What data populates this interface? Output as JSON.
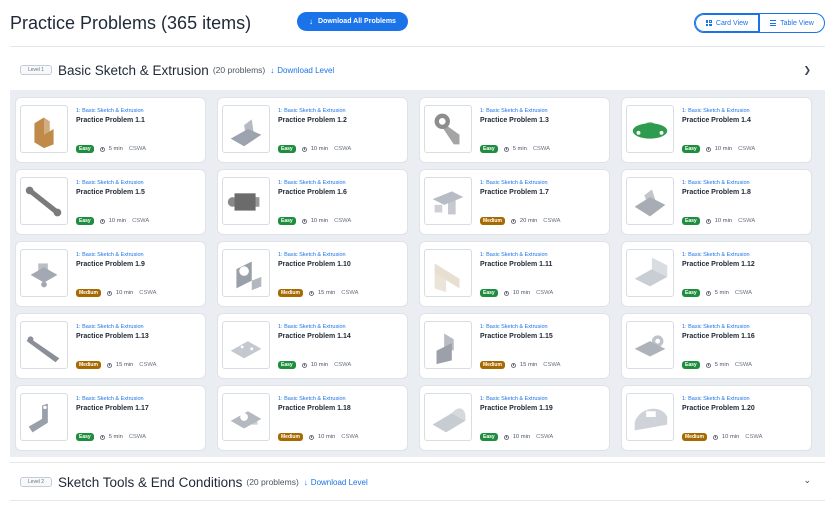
{
  "header": {
    "title": "Practice Problems (365 items)",
    "download_all_label": "Download All Problems",
    "views": [
      {
        "label": "Card View",
        "icon": "grid-icon",
        "active": true
      },
      {
        "label": "Table View",
        "icon": "list-icon",
        "active": false
      }
    ]
  },
  "levels": [
    {
      "badge": "Level 1",
      "title": "Basic Sketch & Extrusion",
      "count": "(20 problems)",
      "download_label": "Download Level",
      "chevron": "chevron-right-icon",
      "expanded": true
    },
    {
      "badge": "Level 2",
      "title": "Sketch Tools & End Conditions",
      "count": "(20 problems)",
      "download_label": "Download Level",
      "chevron": "chevron-down-icon",
      "expanded": false
    }
  ],
  "colors": {
    "accent": "#1a73e8",
    "easy": "#1e8e3e",
    "medium": "#a66a00",
    "panel_bg": "#eaedf1"
  },
  "cards": [
    {
      "category": "1: Basic Sketch & Extrusion",
      "title": "Practice Problem 1.1",
      "difficulty": "Easy",
      "time": "5 min",
      "tag": "CSWA",
      "part_color": "#c08a4a"
    },
    {
      "category": "1: Basic Sketch & Extrusion",
      "title": "Practice Problem 1.2",
      "difficulty": "Easy",
      "time": "10 min",
      "tag": "CSWA",
      "part_color": "#9ca3af"
    },
    {
      "category": "1: Basic Sketch & Extrusion",
      "title": "Practice Problem 1.3",
      "difficulty": "Easy",
      "time": "5 min",
      "tag": "CSWA",
      "part_color": "#8d8d8d"
    },
    {
      "category": "1: Basic Sketch & Extrusion",
      "title": "Practice Problem 1.4",
      "difficulty": "Easy",
      "time": "10 min",
      "tag": "CSWA",
      "part_color": "#2e9b4f"
    },
    {
      "category": "1: Basic Sketch & Extrusion",
      "title": "Practice Problem 1.5",
      "difficulty": "Easy",
      "time": "10 min",
      "tag": "CSWA",
      "part_color": "#7b7b7b"
    },
    {
      "category": "1: Basic Sketch & Extrusion",
      "title": "Practice Problem 1.6",
      "difficulty": "Easy",
      "time": "10 min",
      "tag": "CSWA",
      "part_color": "#6b6b6b"
    },
    {
      "category": "1: Basic Sketch & Extrusion",
      "title": "Practice Problem 1.7",
      "difficulty": "Medium",
      "time": "20 min",
      "tag": "CSWA",
      "part_color": "#b8bcc4"
    },
    {
      "category": "1: Basic Sketch & Extrusion",
      "title": "Practice Problem 1.8",
      "difficulty": "Easy",
      "time": "10 min",
      "tag": "CSWA",
      "part_color": "#a8acb4"
    },
    {
      "category": "1: Basic Sketch & Extrusion",
      "title": "Practice Problem 1.9",
      "difficulty": "Medium",
      "time": "10 min",
      "tag": "CSWA",
      "part_color": "#a3a8b2"
    },
    {
      "category": "1: Basic Sketch & Extrusion",
      "title": "Practice Problem 1.10",
      "difficulty": "Medium",
      "time": "15 min",
      "tag": "CSWA",
      "part_color": "#9aa0aa"
    },
    {
      "category": "1: Basic Sketch & Extrusion",
      "title": "Practice Problem 1.11",
      "difficulty": "Easy",
      "time": "10 min",
      "tag": "CSWA",
      "part_color": "#e7e0d2"
    },
    {
      "category": "1: Basic Sketch & Extrusion",
      "title": "Practice Problem 1.12",
      "difficulty": "Easy",
      "time": "5 min",
      "tag": "CSWA",
      "part_color": "#c9cdd4"
    },
    {
      "category": "1: Basic Sketch & Extrusion",
      "title": "Practice Problem 1.13",
      "difficulty": "Medium",
      "time": "15 min",
      "tag": "CSWA",
      "part_color": "#8b8f97"
    },
    {
      "category": "1: Basic Sketch & Extrusion",
      "title": "Practice Problem 1.14",
      "difficulty": "Easy",
      "time": "10 min",
      "tag": "CSWA",
      "part_color": "#c4c8cf"
    },
    {
      "category": "1: Basic Sketch & Extrusion",
      "title": "Practice Problem 1.15",
      "difficulty": "Medium",
      "time": "15 min",
      "tag": "CSWA",
      "part_color": "#9ca0a8"
    },
    {
      "category": "1: Basic Sketch & Extrusion",
      "title": "Practice Problem 1.16",
      "difficulty": "Easy",
      "time": "5 min",
      "tag": "CSWA",
      "part_color": "#aeb3bb"
    },
    {
      "category": "1: Basic Sketch & Extrusion",
      "title": "Practice Problem 1.17",
      "difficulty": "Easy",
      "time": "5 min",
      "tag": "CSWA",
      "part_color": "#9aa0a9"
    },
    {
      "category": "1: Basic Sketch & Extrusion",
      "title": "Practice Problem 1.18",
      "difficulty": "Medium",
      "time": "10 min",
      "tag": "CSWA",
      "part_color": "#b4b9c1"
    },
    {
      "category": "1: Basic Sketch & Extrusion",
      "title": "Practice Problem 1.19",
      "difficulty": "Easy",
      "time": "10 min",
      "tag": "CSWA",
      "part_color": "#c7cbd2"
    },
    {
      "category": "1: Basic Sketch & Extrusion",
      "title": "Practice Problem 1.20",
      "difficulty": "Medium",
      "time": "10 min",
      "tag": "CSWA",
      "part_color": "#cfd2d8"
    }
  ]
}
